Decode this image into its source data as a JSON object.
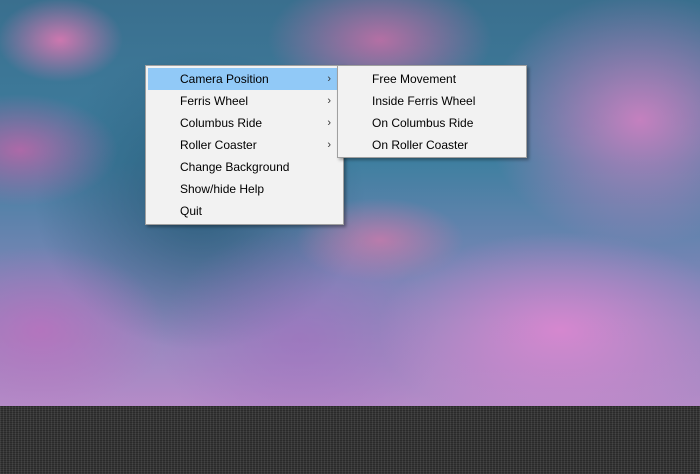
{
  "main_menu": {
    "items": [
      {
        "label": "Camera Position",
        "has_submenu": true,
        "highlighted": true
      },
      {
        "label": "Ferris Wheel",
        "has_submenu": true
      },
      {
        "label": "Columbus Ride",
        "has_submenu": true
      },
      {
        "label": "Roller Coaster",
        "has_submenu": true
      },
      {
        "label": "Change Background",
        "has_submenu": false
      },
      {
        "label": "Show/hide Help",
        "has_submenu": false
      },
      {
        "label": "Quit",
        "has_submenu": false
      }
    ],
    "submenu_arrow": "›"
  },
  "camera_submenu": {
    "items": [
      {
        "label": "Free Movement"
      },
      {
        "label": "Inside Ferris Wheel"
      },
      {
        "label": "On Columbus Ride"
      },
      {
        "label": "On Roller Coaster"
      }
    ]
  },
  "colors": {
    "menu_bg": "#f2f2f2",
    "highlight": "#91c9f7",
    "ground": "#2a2a2a"
  }
}
